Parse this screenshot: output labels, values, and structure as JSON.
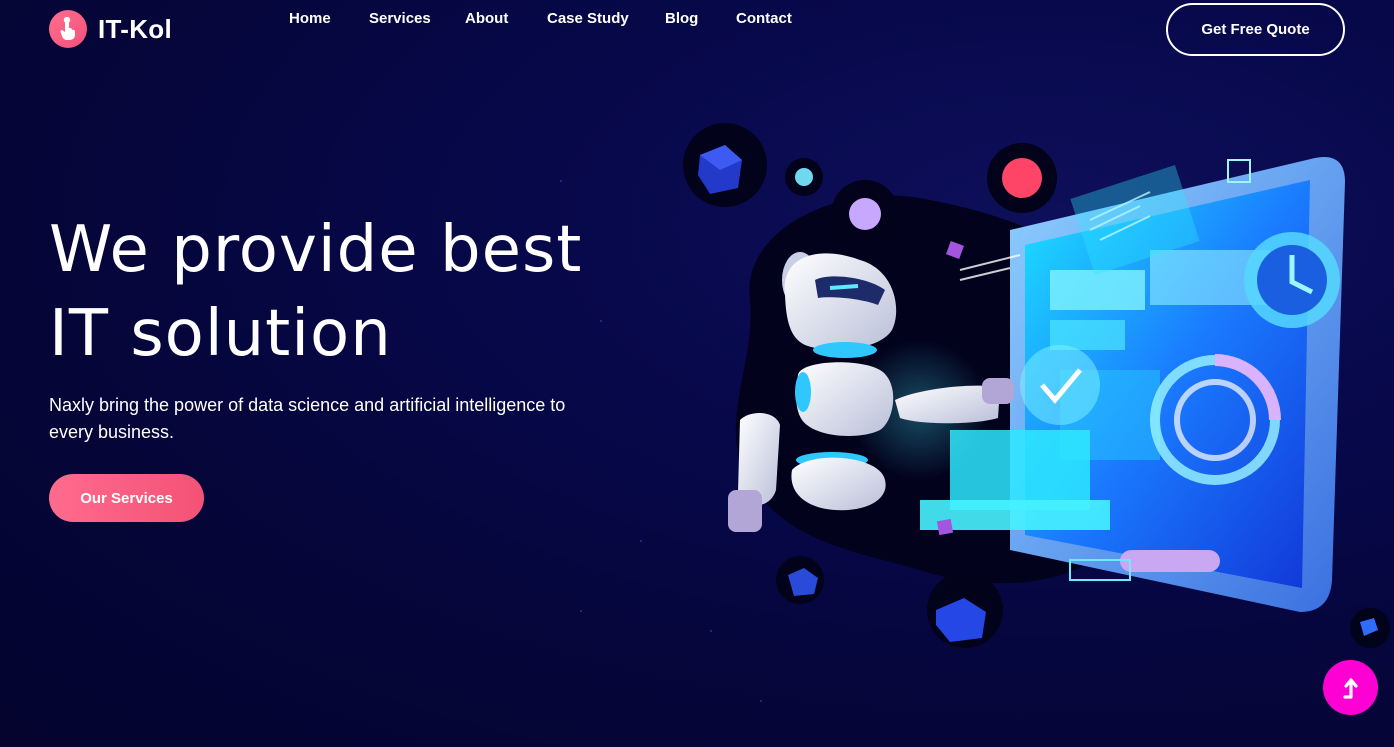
{
  "brand": {
    "name": "IT-Kol",
    "icon": "hand-pointer-icon"
  },
  "nav": {
    "items": [
      {
        "label": "Home"
      },
      {
        "label": "Services"
      },
      {
        "label": "About"
      },
      {
        "label": "Case Study"
      },
      {
        "label": "Blog"
      },
      {
        "label": "Contact"
      }
    ],
    "cta_label": "Get Free Quote"
  },
  "hero": {
    "title_line1": "We provide best",
    "title_line2": "IT solution",
    "description": "Naxly bring the power of data science and artificial intelligence to every business.",
    "button_label": "Our Services"
  },
  "scroll_top": {
    "icon": "arrow-up-icon"
  },
  "colors": {
    "accent_pink": "#f4507a",
    "scroll_magenta": "#ff00d4",
    "background": "#06073f"
  }
}
